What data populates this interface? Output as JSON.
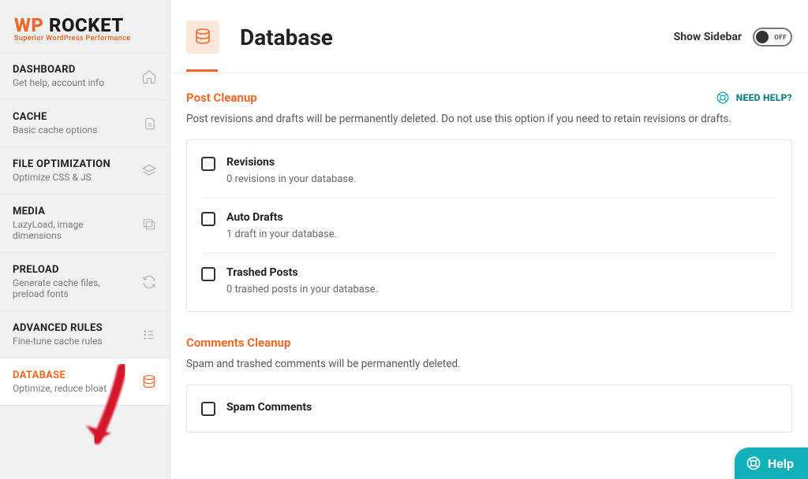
{
  "brand": {
    "wp": "WP",
    "rocket": " ROCKET",
    "tagline": "Superior WordPress Performance"
  },
  "nav": [
    {
      "title": "DASHBOARD",
      "subtitle": "Get help, account info"
    },
    {
      "title": "CACHE",
      "subtitle": "Basic cache options"
    },
    {
      "title": "FILE OPTIMIZATION",
      "subtitle": "Optimize CSS & JS"
    },
    {
      "title": "MEDIA",
      "subtitle": "LazyLoad, image dimensions"
    },
    {
      "title": "PRELOAD",
      "subtitle": "Generate cache files, preload fonts"
    },
    {
      "title": "ADVANCED RULES",
      "subtitle": "Fine-tune cache rules"
    },
    {
      "title": "DATABASE",
      "subtitle": "Optimize, reduce bloat"
    }
  ],
  "header": {
    "title": "Database",
    "show_sidebar": "Show Sidebar",
    "toggle_state": "OFF"
  },
  "need_help": "NEED HELP?",
  "sections": {
    "post_cleanup": {
      "title": "Post Cleanup",
      "desc": "Post revisions and drafts will be permanently deleted. Do not use this option if you need to retain revisions or drafts.",
      "items": [
        {
          "label": "Revisions",
          "sub": "0 revisions in your database."
        },
        {
          "label": "Auto Drafts",
          "sub": "1 draft in your database."
        },
        {
          "label": "Trashed Posts",
          "sub": "0 trashed posts in your database."
        }
      ]
    },
    "comments_cleanup": {
      "title": "Comments Cleanup",
      "desc": "Spam and trashed comments will be permanently deleted.",
      "items": [
        {
          "label": "Spam Comments",
          "sub": ""
        }
      ]
    }
  },
  "help_pill": "Help"
}
